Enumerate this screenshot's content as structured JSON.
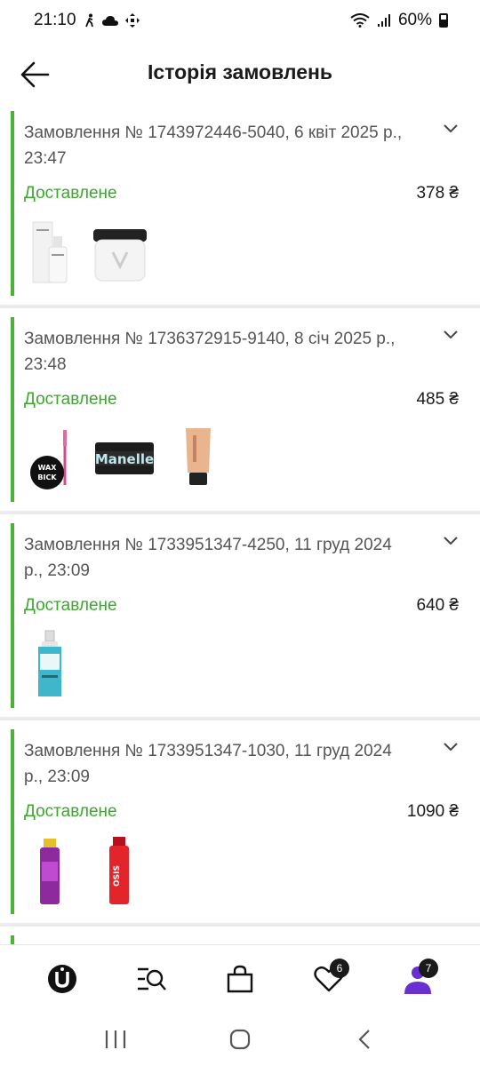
{
  "status_bar": {
    "time": "21:10",
    "battery": "60%"
  },
  "header": {
    "title": "Історія замовлень",
    "back_icon": "arrow-left-icon"
  },
  "orders": [
    {
      "title": "Замовлення № 1743972446-5040, 6 квіт 2025 р., 23:47",
      "status": "Доставлене",
      "sum": "378 ₴",
      "products": [
        "skincare-bottle",
        "white-jar"
      ]
    },
    {
      "title": "Замовлення № 1736372915-9140, 8 січ 2025 р., 23:48",
      "status": "Доставлене",
      "sum": "485 ₴",
      "products": [
        "wax-stick",
        "black-jar",
        "tube"
      ]
    },
    {
      "title": "Замовлення № 1733951347-4250, 11 груд 2024 р., 23:09",
      "status": "Доставлене",
      "sum": "640 ₴",
      "products": [
        "spray-bottle-blue"
      ]
    },
    {
      "title": "Замовлення № 1733951347-1030, 11 груд 2024 р., 23:09",
      "status": "Доставлене",
      "sum": "1090 ₴",
      "products": [
        "spray-can-purple",
        "spray-can-red"
      ]
    }
  ],
  "thumb_labels": {
    "wax": "WAX",
    "stick": "BICK",
    "manelle": "Manelle",
    "osis": "OSIS"
  },
  "bottom_nav": {
    "items": [
      {
        "icon": "home-logo-icon",
        "badge": ""
      },
      {
        "icon": "catalog-search-icon",
        "badge": ""
      },
      {
        "icon": "cart-bag-icon",
        "badge": ""
      },
      {
        "icon": "heart-icon",
        "badge": "6"
      },
      {
        "icon": "profile-icon",
        "badge": "7"
      }
    ]
  },
  "colors": {
    "accent_green": "#4cb13a",
    "status_green": "#3aa82b",
    "profile_purple": "#6a2fd1"
  }
}
